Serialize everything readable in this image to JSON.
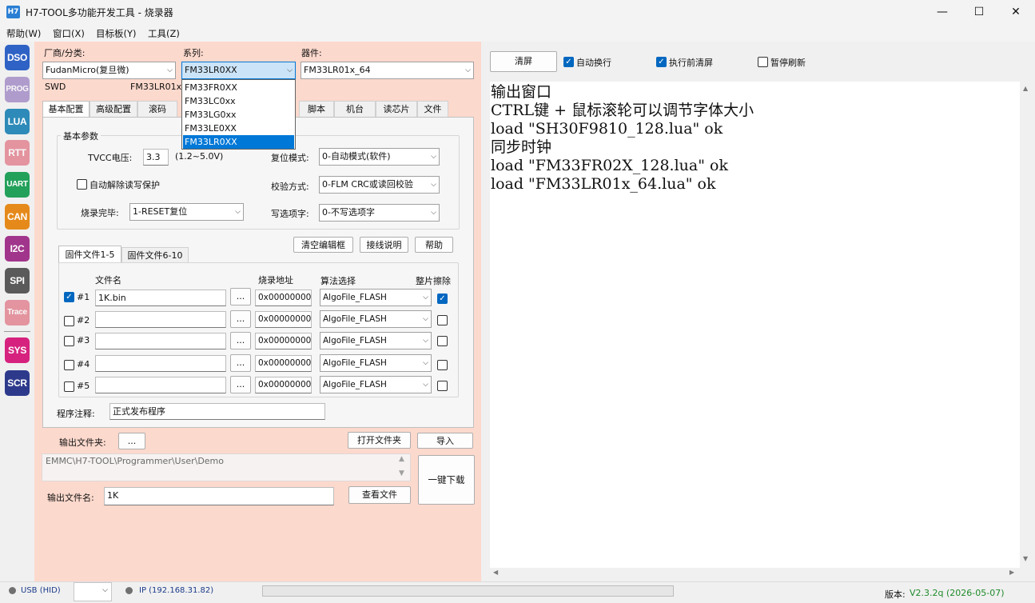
{
  "window": {
    "title": "H7-TOOL多功能开发工具 - 烧录器",
    "icon_text": "H7",
    "minimize": "—",
    "maximize": "☐",
    "close": "✕"
  },
  "menu": [
    "帮助(W)",
    "窗口(X)",
    "目标板(Y)",
    "工具(Z)"
  ],
  "tools": [
    {
      "label": "DSO",
      "color": "#2f62c5"
    },
    {
      "label": "PROG",
      "color": "#7a58b0"
    },
    {
      "label": "LUA",
      "color": "#2e8ab8"
    },
    {
      "label": "RTT",
      "color": "#d9495e"
    },
    {
      "label": "UART",
      "color": "#23a05a"
    },
    {
      "label": "CAN",
      "color": "#e58a1a"
    },
    {
      "label": "I2C",
      "color": "#a1358c"
    },
    {
      "label": "SPI",
      "color": "#5a5a5a"
    },
    {
      "label": "Trace",
      "color": "#d9495e"
    },
    {
      "label": "SYS",
      "color": "#d6227e"
    },
    {
      "label": "SCR",
      "color": "#2d3a8c"
    }
  ],
  "selector": {
    "vendor_label": "厂商/分类:",
    "vendor_value": "FudanMicro(复旦微)",
    "series_label": "系列:",
    "series_value": "FM33LR0XX",
    "device_label": "器件:",
    "device_value": "FM33LR01x_64",
    "interface": "SWD",
    "device_short": "FM33LR01x_",
    "series_options": [
      "FM33FR0XX",
      "FM33LC0xx",
      "FM33LG0xx",
      "FM33LE0XX",
      "FM33LR0XX"
    ],
    "series_selected_index": 4
  },
  "tabs": [
    "基本配置",
    "高级配置",
    "滚码",
    "脚本",
    "机台",
    "读芯片",
    "文件"
  ],
  "basic": {
    "group_title": "基本参数",
    "tvcc_label": "TVCC电压:",
    "tvcc_value": "3.3",
    "tvcc_range": "(1.2~5.0V)",
    "reset_mode_label": "复位模式:",
    "reset_mode_value": "0-自动模式(软件)",
    "auto_unlock_label": "自动解除读写保护",
    "verify_label": "校验方式:",
    "verify_value": "0-FLM CRC或读回校验",
    "finish_label": "烧录完毕:",
    "finish_value": "1-RESET复位",
    "option_label": "写选项字:",
    "option_value": "0-不写选项字",
    "btn_clear": "清空编辑框",
    "btn_wiring": "接线说明",
    "btn_help": "帮助"
  },
  "firmware": {
    "tabs": [
      "固件文件1-5",
      "固件文件6-10"
    ],
    "headers": {
      "name": "文件名",
      "addr": "烧录地址",
      "algo": "算法选择",
      "erase": "整片擦除"
    },
    "rows": [
      {
        "idx": "#1",
        "checked": true,
        "file": "1K.bin",
        "browse": "...",
        "addr": "0x00000000",
        "algo": "AlgoFile_FLASH",
        "erase": true
      },
      {
        "idx": "#2",
        "checked": false,
        "file": "",
        "browse": "...",
        "addr": "0x00000000",
        "algo": "AlgoFile_FLASH",
        "erase": false
      },
      {
        "idx": "#3",
        "checked": false,
        "file": "",
        "browse": "...",
        "addr": "0x00000000",
        "algo": "AlgoFile_FLASH",
        "erase": false
      },
      {
        "idx": "#4",
        "checked": false,
        "file": "",
        "browse": "...",
        "addr": "0x00000000",
        "algo": "AlgoFile_FLASH",
        "erase": false
      },
      {
        "idx": "#5",
        "checked": false,
        "file": "",
        "browse": "...",
        "addr": "0x00000000",
        "algo": "AlgoFile_FLASH",
        "erase": false
      }
    ],
    "note_label": "程序注释:",
    "note_value": "正式发布程序"
  },
  "output": {
    "folder_label": "输出文件夹:",
    "folder_btn": "...",
    "open_folder": "打开文件夹",
    "import": "导入",
    "path": "EMMC\\H7-TOOL\\Programmer\\User\\Demo",
    "one_key": "一键下载",
    "filename_label": "输出文件名:",
    "filename_value": "1K",
    "view_file": "查看文件"
  },
  "console": {
    "clear_btn": "清屏",
    "auto_wrap": "自动换行",
    "auto_wrap_checked": true,
    "clear_before": "执行前清屏",
    "clear_before_checked": true,
    "pause_refresh": "暂停刷新",
    "pause_refresh_checked": false,
    "lines": [
      "输出窗口",
      "CTRL键 + 鼠标滚轮可以调节字体大小",
      "load \"SH30F9810_128.lua\" ok",
      "同步时钟",
      "load \"FM33FR02X_128.lua\" ok",
      "load \"FM33LR01x_64.lua\" ok"
    ]
  },
  "status": {
    "usb": "USB (HID)",
    "ip": "IP (192.168.31.82)",
    "version_label": "版本:",
    "version_value": "V2.3.2q (2026-05-07)"
  }
}
